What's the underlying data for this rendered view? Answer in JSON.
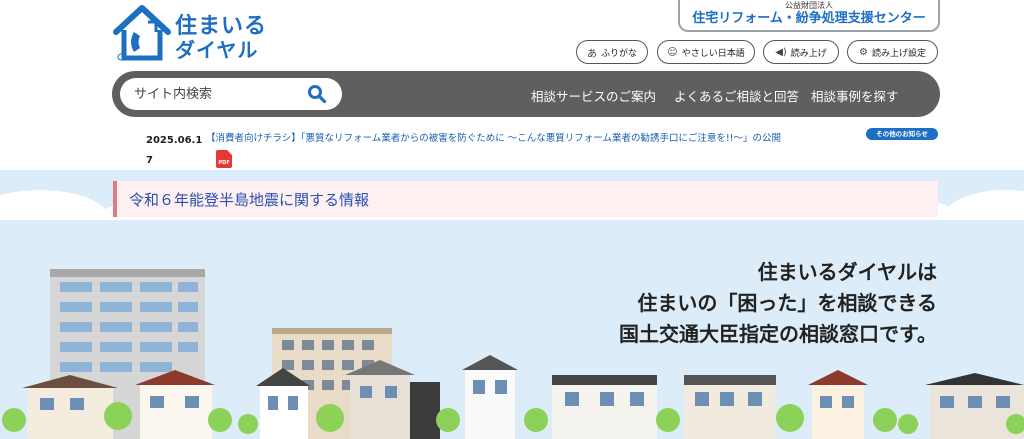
{
  "logo": {
    "line1": "住まいる",
    "line2": "ダイヤル"
  },
  "org": {
    "type": "公益財団法人",
    "name": "住宅リフォーム・紛争処理支援センター"
  },
  "utility_buttons": [
    {
      "label": "ふりがな",
      "icon": "furigana-icon"
    },
    {
      "label": "やさしい日本語",
      "icon": "easy-japanese-icon"
    },
    {
      "label": "読み上げ",
      "icon": "speaker-icon"
    },
    {
      "label": "読み上げ設定",
      "icon": "gear-icon"
    }
  ],
  "search": {
    "placeholder": "サイト内検索"
  },
  "nav": [
    {
      "label": "相談サービスのご案内"
    },
    {
      "label": "よくあるご相談と回答"
    },
    {
      "label": "相談事例を探す"
    }
  ],
  "news": {
    "date": "2025.06.17",
    "link": "【消費者向けチラシ】「悪質なリフォーム業者からの被害を防ぐために ～こんな悪質リフォーム業者の勧誘手口にご注意を!!～」の公開",
    "pdf": "PDF",
    "more": "その他のお知らせ"
  },
  "notice": {
    "text": "令和６年能登半島地震に関する情報"
  },
  "hero": {
    "line1": "住まいるダイヤルは",
    "line2": "住まいの「困った」を相談できる",
    "line3": "国土交通大臣指定の相談窓口です。"
  },
  "colors": {
    "brand": "#1e6fc3",
    "nav": "#5f5f5f",
    "notice_bg": "#fdf0f1",
    "notice_accent": "#e07b86",
    "sky": "#dcedf9"
  }
}
